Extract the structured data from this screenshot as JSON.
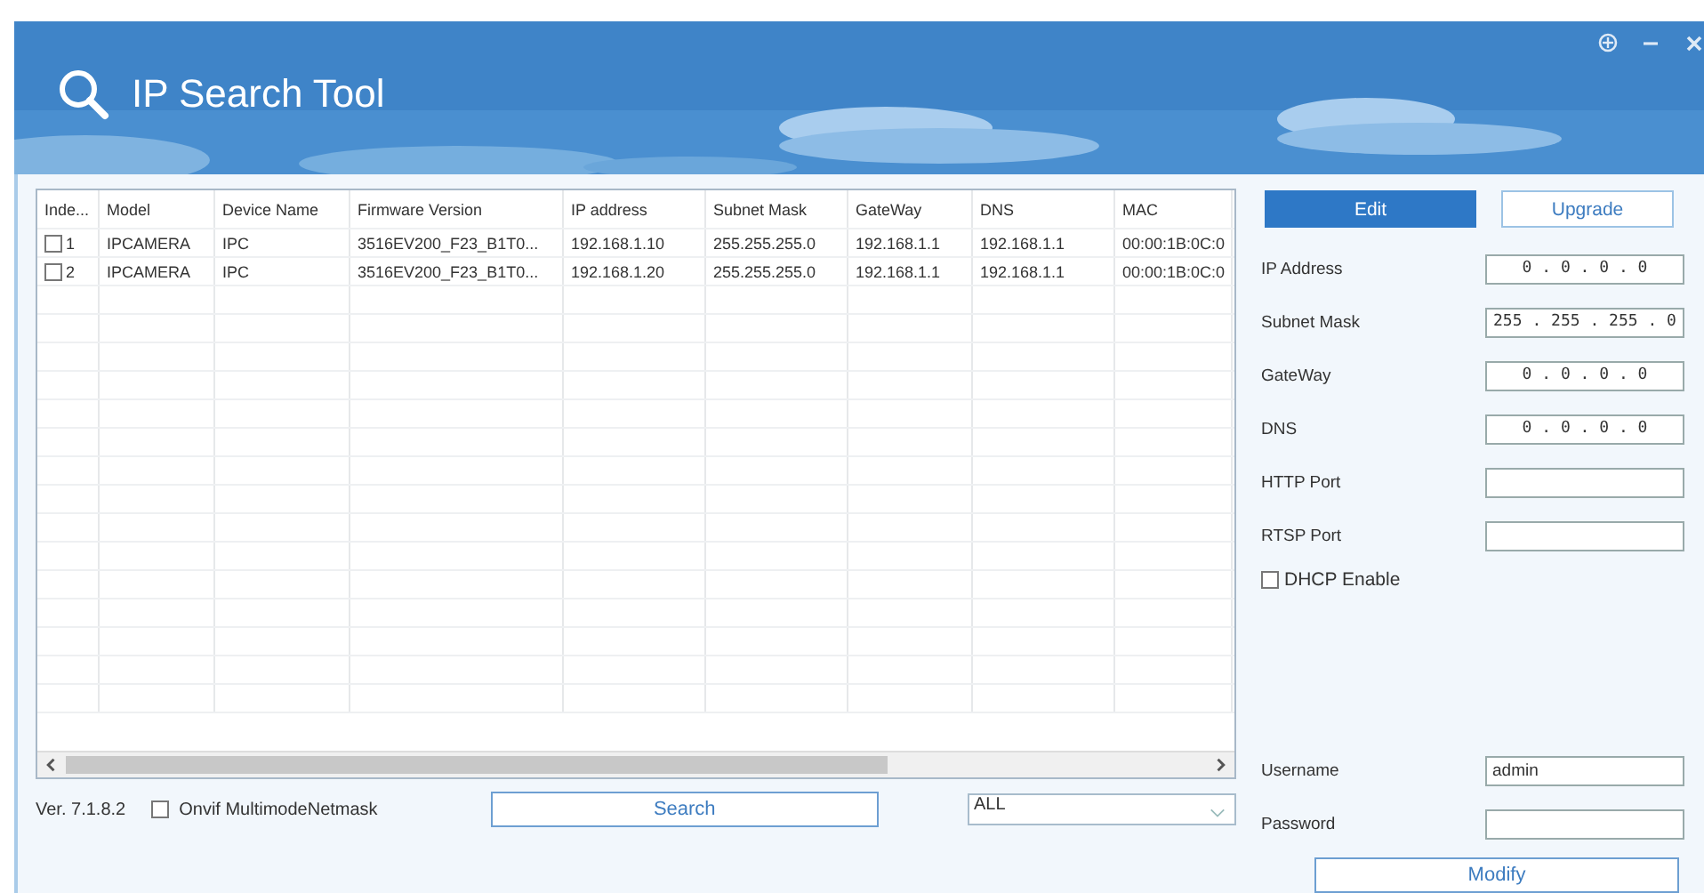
{
  "window": {
    "title": "IP Search Tool"
  },
  "table": {
    "columns": [
      "Inde...",
      "Model",
      "Device Name",
      "Firmware Version",
      "IP address",
      "Subnet Mask",
      "GateWay",
      "DNS",
      "MAC"
    ],
    "rows": [
      {
        "checked": false,
        "cells": [
          "1",
          "IPCAMERA",
          "IPC",
          "3516EV200_F23_B1T0...",
          "192.168.1.10",
          "255.255.255.0",
          "192.168.1.1",
          "192.168.1.1",
          "00:00:1B:0C:0"
        ]
      },
      {
        "checked": false,
        "cells": [
          "2",
          "IPCAMERA",
          "IPC",
          "3516EV200_F23_B1T0...",
          "192.168.1.20",
          "255.255.255.0",
          "192.168.1.1",
          "192.168.1.1",
          "00:00:1B:0C:0"
        ]
      }
    ]
  },
  "footer": {
    "version": "Ver. 7.1.8.2",
    "onvif": {
      "label": "Onvif MultimodeNetmask",
      "checked": false
    },
    "search_button": "Search",
    "filter": {
      "value": "ALL"
    }
  },
  "panel": {
    "tabs": [
      {
        "label": "Edit",
        "selected": true
      },
      {
        "label": "Upgrade",
        "selected": false
      }
    ],
    "fields": [
      {
        "kind": "ip",
        "label": "IP Address",
        "value": "0 . 0 . 0 . 0"
      },
      {
        "kind": "ip",
        "label": "Subnet Mask",
        "value": "255 . 255 . 255 . 0"
      },
      {
        "kind": "ip",
        "label": "GateWay",
        "value": "0 . 0 . 0 . 0"
      },
      {
        "kind": "ip",
        "label": "DNS",
        "value": "0 . 0 . 0 . 0"
      },
      {
        "kind": "text",
        "label": "HTTP Port"
      },
      {
        "kind": "text",
        "label": "RTSP Port"
      }
    ],
    "dhcp": {
      "label": "DHCP Enable",
      "checked": false
    },
    "username": {
      "label": "Username",
      "value": "admin"
    },
    "password": {
      "label": "Password"
    },
    "modify_button": "Modify"
  }
}
